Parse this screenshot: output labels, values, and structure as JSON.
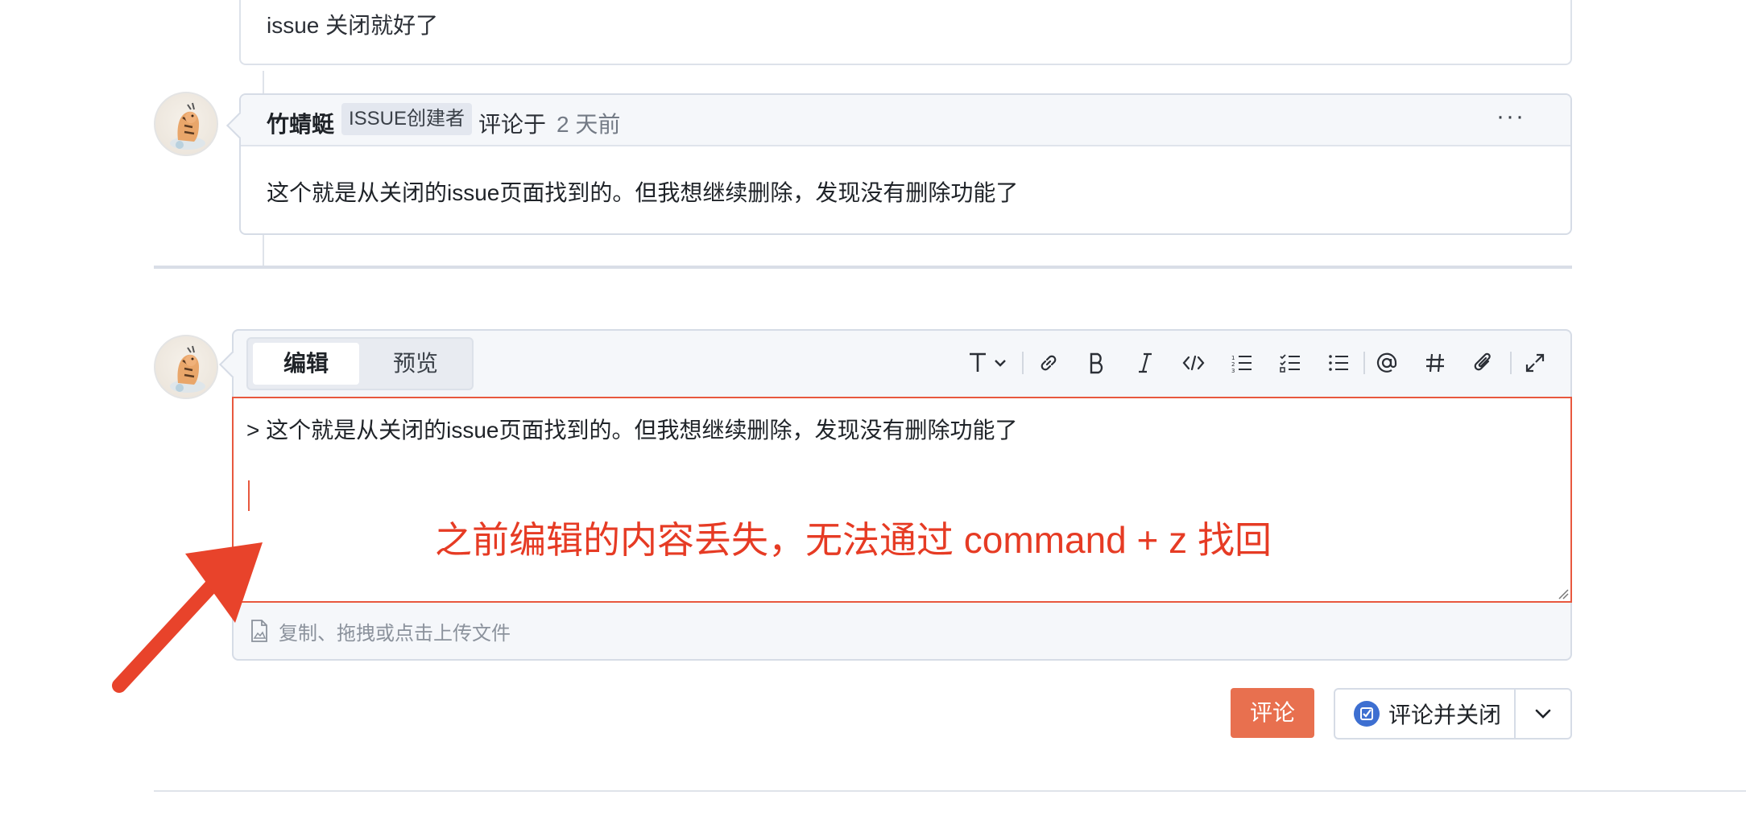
{
  "previous_comment": {
    "body": "issue 关闭就好了"
  },
  "comment": {
    "author": "竹蜻蜓",
    "badge": "ISSUE创建者",
    "action": "评论于",
    "time_ago": "2 天前",
    "more_label": "···",
    "body": "这个就是从关闭的issue页面找到的。但我想继续删除，发现没有删除功能了"
  },
  "editor": {
    "tabs": [
      {
        "label": "编辑",
        "active": true
      },
      {
        "label": "预览",
        "active": false
      }
    ],
    "toolbar": [
      "text-style-icon",
      "link-icon",
      "bold-icon",
      "italic-icon",
      "code-icon",
      "ordered-list-icon",
      "task-list-icon",
      "bullet-list-icon",
      "mention-icon",
      "hash-icon",
      "attachment-icon",
      "fullscreen-icon"
    ],
    "content_quote": "> 这个就是从关闭的issue页面找到的。但我想继续删除，发现没有删除功能了",
    "annotation": "之前编辑的内容丢失，无法通过 command + z 找回",
    "upload_hint": "复制、拖拽或点击上传文件"
  },
  "actions": {
    "comment_label": "评论",
    "comment_and_close_label": "评论并关闭"
  },
  "colors": {
    "accent": "#e8704f",
    "annotation_red": "#e63b24",
    "focus_border": "#e8583e"
  }
}
